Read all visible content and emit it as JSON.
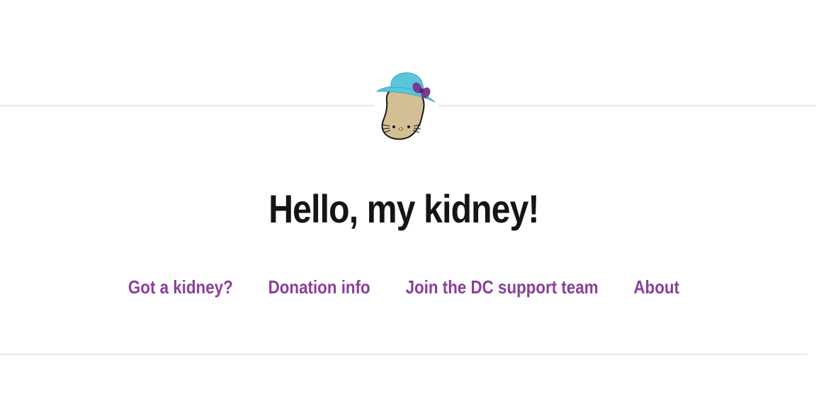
{
  "site": {
    "logo_icon": "kidney-bean-with-hat-icon",
    "title": "Hello, my kidney!"
  },
  "nav": {
    "items": [
      {
        "label": "Got a kidney?"
      },
      {
        "label": "Donation info"
      },
      {
        "label": "Join the DC support team"
      },
      {
        "label": "About"
      }
    ]
  },
  "colors": {
    "title": "#151515",
    "nav_link": "#893f9a",
    "hat": "#5bc6d9",
    "bow": "#7b3a98",
    "kidney": "#d2bf94",
    "divider": "#e8e8e8"
  }
}
